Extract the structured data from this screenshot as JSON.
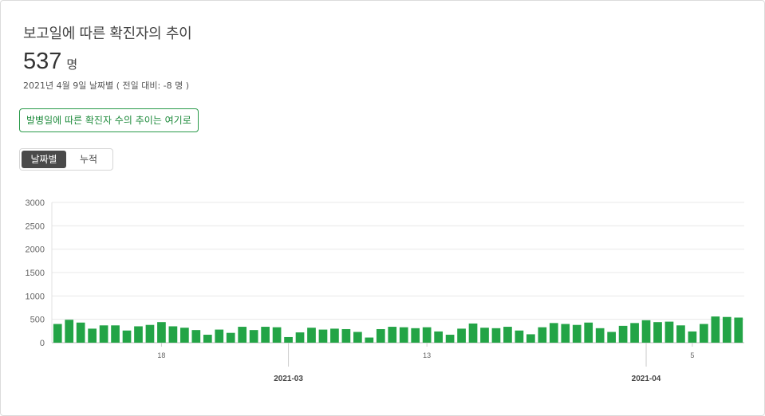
{
  "header": {
    "title": "보고일에 따른 확진자의 추이",
    "big_number": "537",
    "big_unit": "명",
    "subtitle": "2021년 4월 9일 날짜별 ( 전일 대비: -8 명 )"
  },
  "link_button": {
    "label": "발병일에 따른 확진자 수의 추이는 여기로"
  },
  "toggle": {
    "daily_label": "날짜별",
    "cumulative_label": "누적",
    "selected": "daily"
  },
  "colors": {
    "bar": "#23a446",
    "accent": "#1e8b3c",
    "toggle_active": "#4a4a4a",
    "grid": "#e8e8e8"
  },
  "chart_data": {
    "type": "bar",
    "title": "",
    "xlabel": "",
    "ylabel": "",
    "ylim": [
      0,
      3000
    ],
    "yticks": [
      0,
      500,
      1000,
      1500,
      2000,
      2500,
      3000
    ],
    "grid": true,
    "categories": [
      "2021-02-09",
      "2021-02-10",
      "2021-02-11",
      "2021-02-12",
      "2021-02-13",
      "2021-02-14",
      "2021-02-15",
      "2021-02-16",
      "2021-02-17",
      "2021-02-18",
      "2021-02-19",
      "2021-02-20",
      "2021-02-21",
      "2021-02-22",
      "2021-02-23",
      "2021-02-24",
      "2021-02-25",
      "2021-02-26",
      "2021-02-27",
      "2021-02-28",
      "2021-03-01",
      "2021-03-02",
      "2021-03-03",
      "2021-03-04",
      "2021-03-05",
      "2021-03-06",
      "2021-03-07",
      "2021-03-08",
      "2021-03-09",
      "2021-03-10",
      "2021-03-11",
      "2021-03-12",
      "2021-03-13",
      "2021-03-14",
      "2021-03-15",
      "2021-03-16",
      "2021-03-17",
      "2021-03-18",
      "2021-03-19",
      "2021-03-20",
      "2021-03-21",
      "2021-03-22",
      "2021-03-23",
      "2021-03-24",
      "2021-03-25",
      "2021-03-26",
      "2021-03-27",
      "2021-03-28",
      "2021-03-29",
      "2021-03-30",
      "2021-03-31",
      "2021-04-01",
      "2021-04-02",
      "2021-04-03",
      "2021-04-04",
      "2021-04-05",
      "2021-04-06",
      "2021-04-07",
      "2021-04-08",
      "2021-04-09"
    ],
    "values": [
      400,
      490,
      430,
      300,
      370,
      370,
      260,
      350,
      380,
      440,
      350,
      320,
      270,
      170,
      280,
      210,
      340,
      270,
      340,
      330,
      120,
      220,
      320,
      280,
      300,
      290,
      230,
      110,
      290,
      340,
      330,
      310,
      330,
      240,
      170,
      300,
      410,
      320,
      310,
      340,
      260,
      180,
      330,
      420,
      400,
      380,
      430,
      310,
      230,
      360,
      420,
      480,
      440,
      450,
      370,
      240,
      400,
      560,
      550,
      537
    ],
    "x_minor_ticks": [
      {
        "date": "2021-02-18",
        "label": "18"
      },
      {
        "date": "2021-03-13",
        "label": "13"
      },
      {
        "date": "2021-04-05",
        "label": "5"
      }
    ],
    "x_major_ticks": [
      {
        "date": "2021-03-01",
        "label": "2021-03"
      },
      {
        "date": "2021-04-01",
        "label": "2021-04"
      }
    ]
  }
}
